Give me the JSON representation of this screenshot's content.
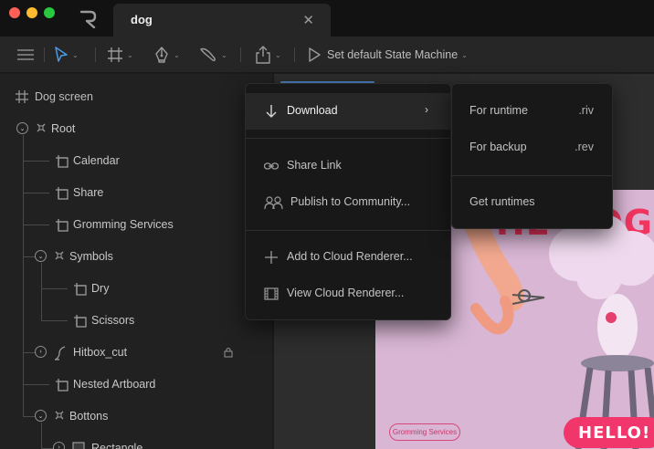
{
  "window": {
    "document_title": "dog",
    "close_glyph": "✕"
  },
  "toolbar": {
    "state_machine_label": "Set default State Machine",
    "caret": "⌄",
    "icons": [
      "menu-icon",
      "select-pointer-icon",
      "artboard-frame-icon",
      "pen-tool-icon",
      "paint-brush-icon",
      "export-icon",
      "play-icon"
    ]
  },
  "hierarchy": {
    "title": "Dog screen",
    "items": [
      {
        "label": "Root",
        "depth": 0,
        "expandable": true,
        "icon": "group-icon"
      },
      {
        "label": "Calendar",
        "depth": 1,
        "expandable": false,
        "icon": "frame-icon"
      },
      {
        "label": "Share",
        "depth": 1,
        "expandable": false,
        "icon": "frame-icon"
      },
      {
        "label": "Gromming Services",
        "depth": 1,
        "expandable": false,
        "icon": "frame-icon"
      },
      {
        "label": "Symbols",
        "depth": 1,
        "expandable": true,
        "icon": "group-icon"
      },
      {
        "label": "Dry",
        "depth": 2,
        "expandable": false,
        "icon": "frame-icon"
      },
      {
        "label": "Scissors",
        "depth": 2,
        "expandable": false,
        "icon": "frame-icon"
      },
      {
        "label": "Hitbox_cut",
        "depth": 1,
        "expandable": true,
        "icon": "path-icon",
        "locked": true
      },
      {
        "label": "Nested Artboard",
        "depth": 1,
        "expandable": false,
        "icon": "frame-icon"
      },
      {
        "label": "Bottons",
        "depth": 1,
        "expandable": true,
        "icon": "group-icon"
      },
      {
        "label": "Rectangle",
        "depth": 2,
        "expandable": true,
        "icon": "rectangle-icon"
      }
    ]
  },
  "export_menu": {
    "download": "Download",
    "share_link": "Share Link",
    "publish": "Publish to Community...",
    "add_cloud": "Add to Cloud Renderer...",
    "view_cloud": "View Cloud Renderer...",
    "submenu_arrow": "›"
  },
  "download_submenu": {
    "runtime_label": "For runtime",
    "runtime_ext": ".riv",
    "backup_label": "For backup",
    "backup_ext": ".rev",
    "get_runtimes": "Get runtimes"
  },
  "artboard": {
    "pill_button": "Gromming Services",
    "badge": "HELLO!"
  },
  "colors": {
    "accent": "#4b7fbd",
    "brand_pink": "#f0366a",
    "artboard_bg": "#d8b6d4"
  }
}
